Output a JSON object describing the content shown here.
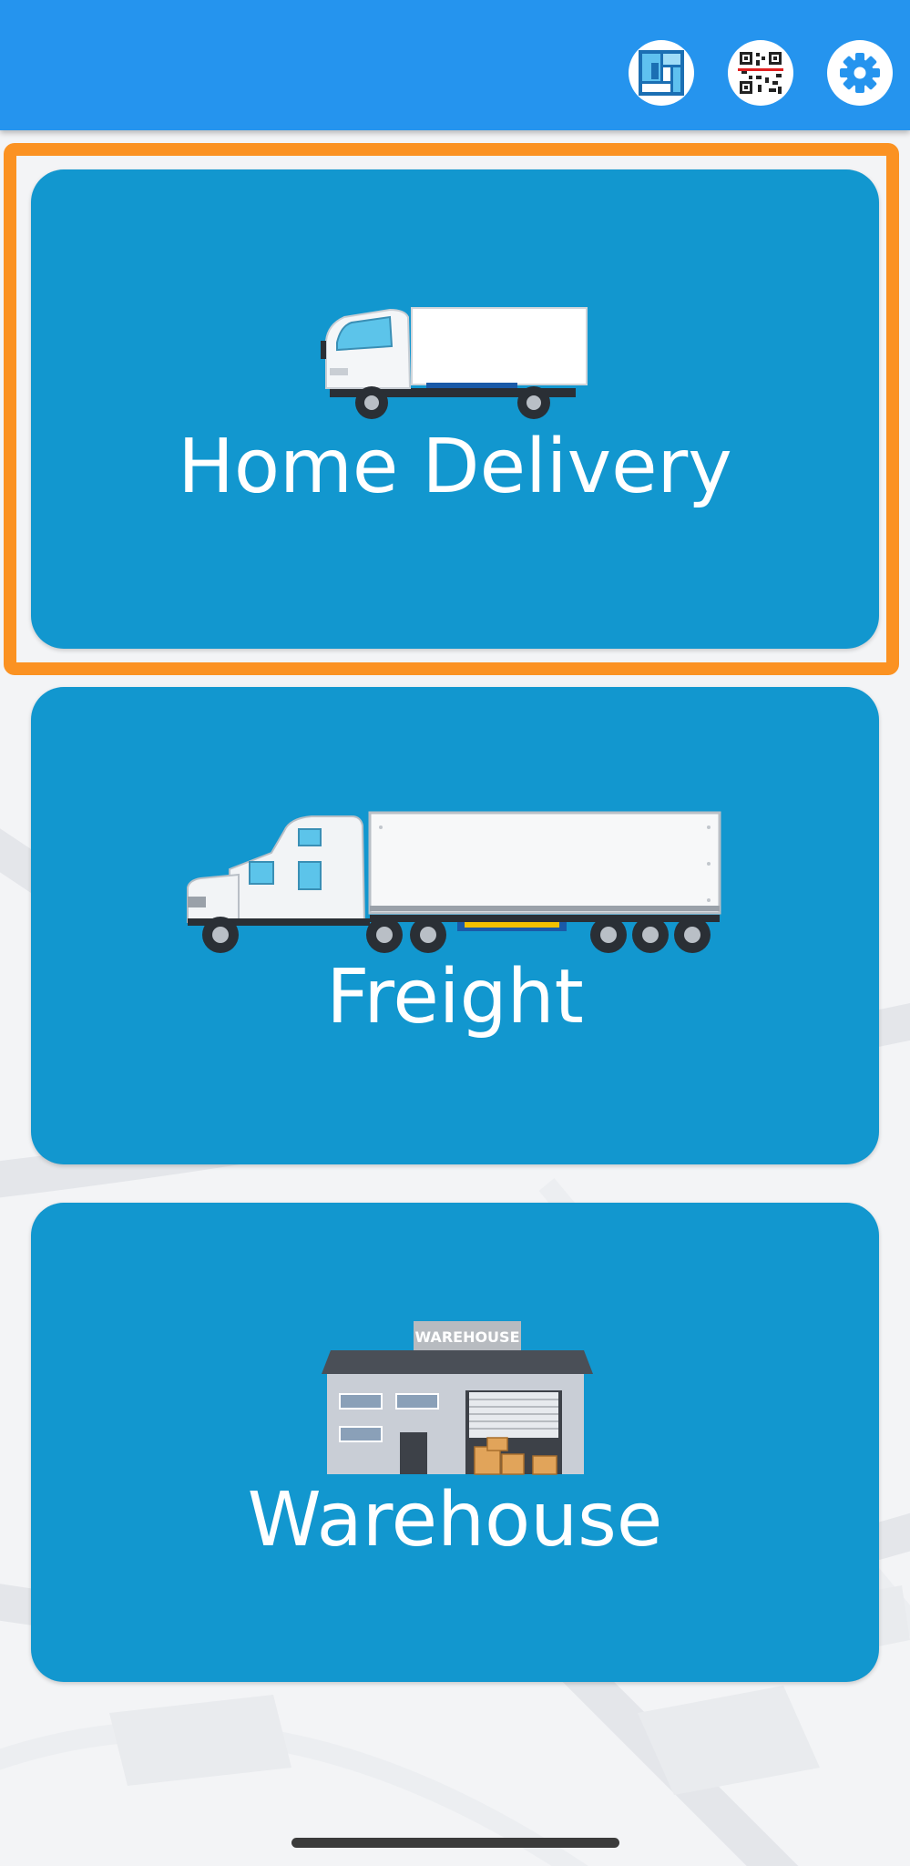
{
  "header": {
    "background_color": "#2594ee",
    "buttons": [
      {
        "name": "layout-icon"
      },
      {
        "name": "qr-code-icon"
      },
      {
        "name": "gear-icon"
      }
    ]
  },
  "highlight_color": "#fb9222",
  "cards": [
    {
      "label": "Home Delivery",
      "icon": "box-truck-icon",
      "highlighted": true
    },
    {
      "label": "Freight",
      "icon": "semi-truck-icon",
      "highlighted": false
    },
    {
      "label": "Warehouse",
      "icon": "warehouse-icon",
      "sign_text": "WAREHOUSE",
      "highlighted": false
    }
  ],
  "card_color": "#1297cf"
}
